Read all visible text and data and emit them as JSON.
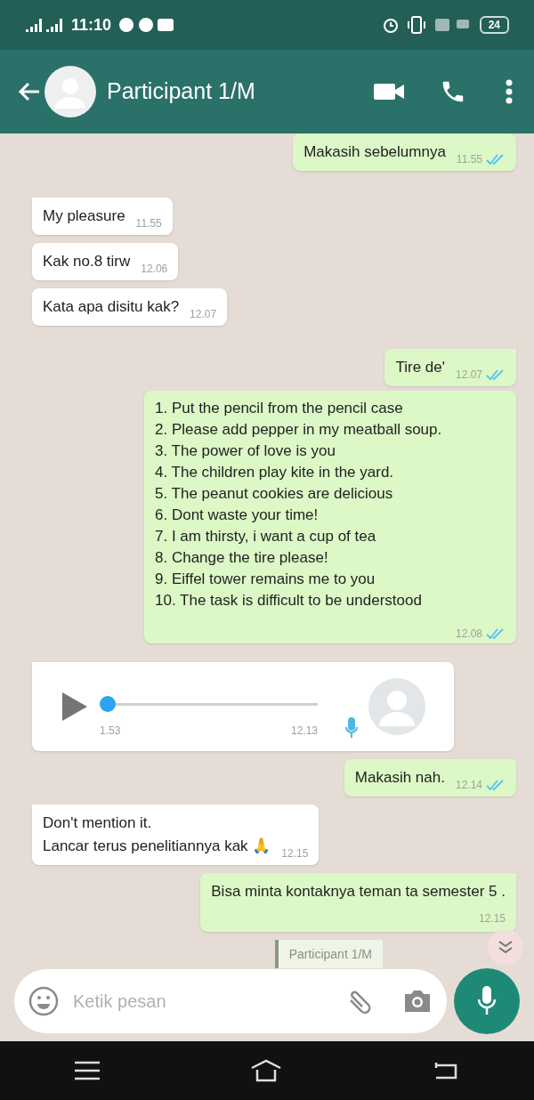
{
  "status_bar": {
    "time": "11:10",
    "battery": "24"
  },
  "header": {
    "title": "Participant 1/M"
  },
  "messages": [
    {
      "kind": "text",
      "outgoing": true,
      "read": true,
      "text": "Makasih sebelumnya",
      "time": "11.55",
      "tail": false
    },
    {
      "kind": "text",
      "outgoing": false,
      "text": "My pleasure",
      "time": "11.55",
      "tail": true
    },
    {
      "kind": "text",
      "outgoing": false,
      "text": "Kak no.8 tirw",
      "time": "12.06",
      "tail": false
    },
    {
      "kind": "text",
      "outgoing": false,
      "text": "Kata apa disitu kak?",
      "time": "12.07",
      "tail": false
    },
    {
      "kind": "text",
      "outgoing": true,
      "read": true,
      "text": "Tire de'",
      "time": "12.07",
      "tail": true
    },
    {
      "kind": "list",
      "outgoing": true,
      "read": true,
      "lines": [
        "1. Put the pencil from the pencil case",
        "2. Please add pepper in my meatball soup.",
        "3. The power of love is you",
        "4. The children play kite in the yard.",
        "5. The peanut cookies are delicious",
        "6. Dont waste your time!",
        "7. I am thirsty, i want a cup of tea",
        "8. Change the tire please!",
        "9. Eiffel tower remains me to you",
        "10. The task is difficult to be understood"
      ],
      "time": "12.08",
      "tail": false
    },
    {
      "kind": "voice",
      "outgoing": false,
      "level": 0,
      "duration": "1.53",
      "time": "12.13",
      "tail": true
    },
    {
      "kind": "text",
      "outgoing": true,
      "read": true,
      "text": "Makasih nah.",
      "time": "12.14",
      "tail": true
    },
    {
      "kind": "text",
      "outgoing": false,
      "text": "Don't mention it.\nLancar terus penelitiannya kak 🙏",
      "time": "12.15",
      "tail": true
    },
    {
      "kind": "text",
      "outgoing": true,
      "text": "Bisa minta kontaknya teman ta semester 5 .",
      "time": "12.15",
      "tail": true,
      "wide": true
    },
    {
      "kind": "quote",
      "text": "Participant 1/M"
    }
  ],
  "composer": {
    "placeholder": "Ketik pesan"
  }
}
